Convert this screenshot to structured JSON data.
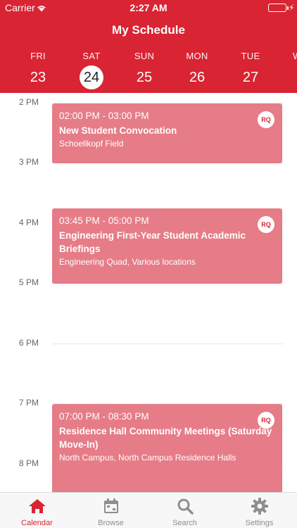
{
  "status_bar": {
    "carrier": "Carrier",
    "time": "2:27 AM"
  },
  "header": {
    "title": "My Schedule"
  },
  "days": [
    {
      "name": "FRI",
      "num": "23",
      "selected": false
    },
    {
      "name": "SAT",
      "num": "24",
      "selected": true
    },
    {
      "name": "SUN",
      "num": "25",
      "selected": false
    },
    {
      "name": "MON",
      "num": "26",
      "selected": false
    },
    {
      "name": "TUE",
      "num": "27",
      "selected": false
    },
    {
      "name": "W",
      "num": "",
      "selected": false
    }
  ],
  "hours": [
    "2 PM",
    "3 PM",
    "4 PM",
    "5 PM",
    "6 PM",
    "7 PM",
    "8 PM"
  ],
  "events": [
    {
      "time": "02:00 PM - 03:00 PM",
      "title": "New Student Convocation",
      "location": "Schoellkopf Field",
      "badge": "RQ"
    },
    {
      "time": "03:45 PM - 05:00 PM",
      "title": "Engineering First-Year Student Academic Briefings",
      "location": "Engineering Quad, Various locations",
      "badge": "RQ"
    },
    {
      "time": "07:00 PM - 08:30 PM",
      "title": "Residence Hall Community Meetings (Saturday Move-In)",
      "location": "North Campus, North Campus Residence Halls",
      "badge": "RQ"
    }
  ],
  "tabs": [
    {
      "label": "Calendar",
      "icon": "home-icon",
      "active": true
    },
    {
      "label": "Browse",
      "icon": "calendar-icon",
      "active": false
    },
    {
      "label": "Search",
      "icon": "search-icon",
      "active": false
    },
    {
      "label": "Settings",
      "icon": "gear-icon",
      "active": false
    }
  ],
  "colors": {
    "brand": "#d92433",
    "event": "#e67c87",
    "inactive": "#8e8e8e"
  }
}
